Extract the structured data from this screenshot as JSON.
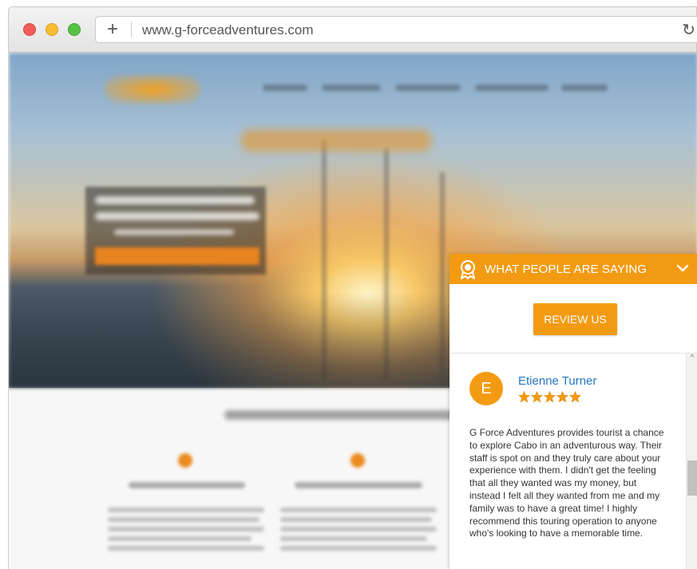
{
  "browser": {
    "url": "www.g-forceadventures.com",
    "new_tab_glyph": "+",
    "reload_glyph": "↻"
  },
  "widget": {
    "header_title": "WHAT PEOPLE ARE SAYING",
    "review_button": "REVIEW US",
    "accent_color": "#f29b12",
    "review": {
      "avatar_initial": "E",
      "reviewer_name": "Etienne Turner",
      "rating": 5,
      "rating_max": 5,
      "text": "G Force Adventures provides tourist a chance to explore Cabo in an adventurous way. Their staff is spot on and they truly care about your experience with them. I didn't get the feeling that all they wanted was my money, but instead I felt all they wanted from me and my family was to have a great time! I highly recommend this touring operation to anyone who's looking to have a memorable time."
    }
  }
}
